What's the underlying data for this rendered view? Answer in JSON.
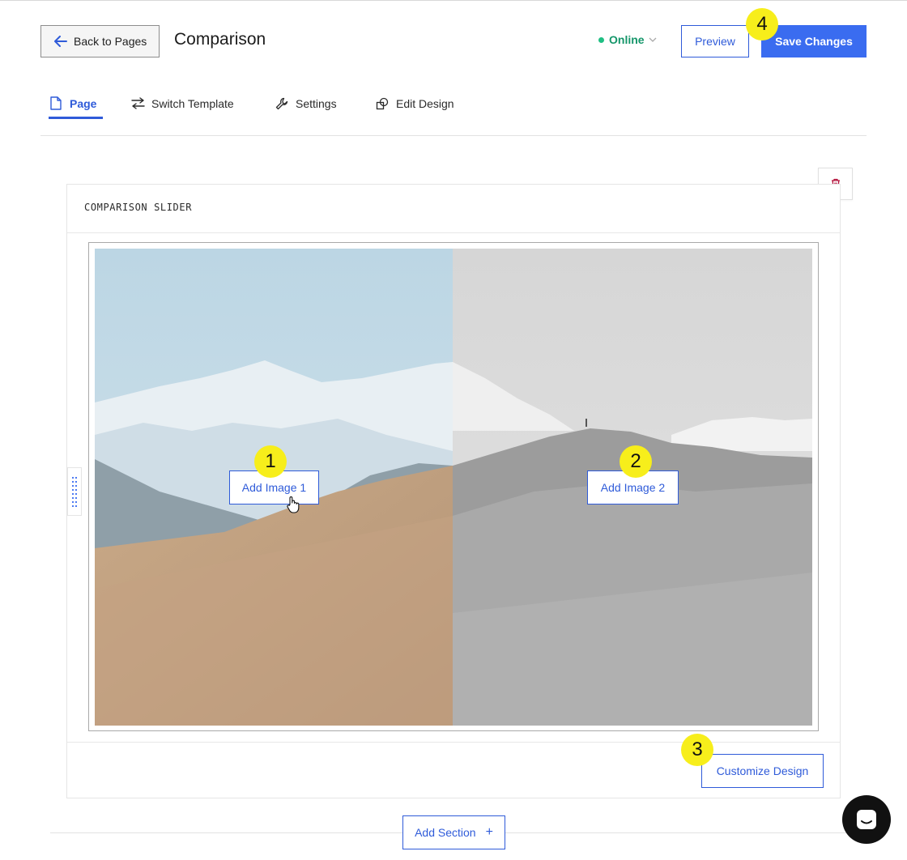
{
  "header": {
    "back_label": "Back to Pages",
    "title": "Comparison",
    "status_label": "Online",
    "preview_label": "Preview",
    "save_label": "Save Changes"
  },
  "tabs": [
    {
      "label": "Page",
      "icon": "page-icon",
      "active": true
    },
    {
      "label": "Switch Template",
      "icon": "switch-icon",
      "active": false
    },
    {
      "label": "Settings",
      "icon": "wrench-icon",
      "active": false
    },
    {
      "label": "Edit Design",
      "icon": "design-icon",
      "active": false
    }
  ],
  "section": {
    "title": "COMPARISON SLIDER",
    "add_image_1": "Add Image 1",
    "add_image_2": "Add Image 2",
    "customize_label": "Customize Design"
  },
  "footer": {
    "add_section_label": "Add Section",
    "add_section_icon": "+"
  },
  "callouts": [
    "1",
    "2",
    "3",
    "4"
  ],
  "colors": {
    "accent": "#3a6cf0",
    "link": "#2f5bd9",
    "status_green": "#1fbf83",
    "callout_yellow": "#f7ee1b",
    "delete_red": "#b3123b"
  }
}
